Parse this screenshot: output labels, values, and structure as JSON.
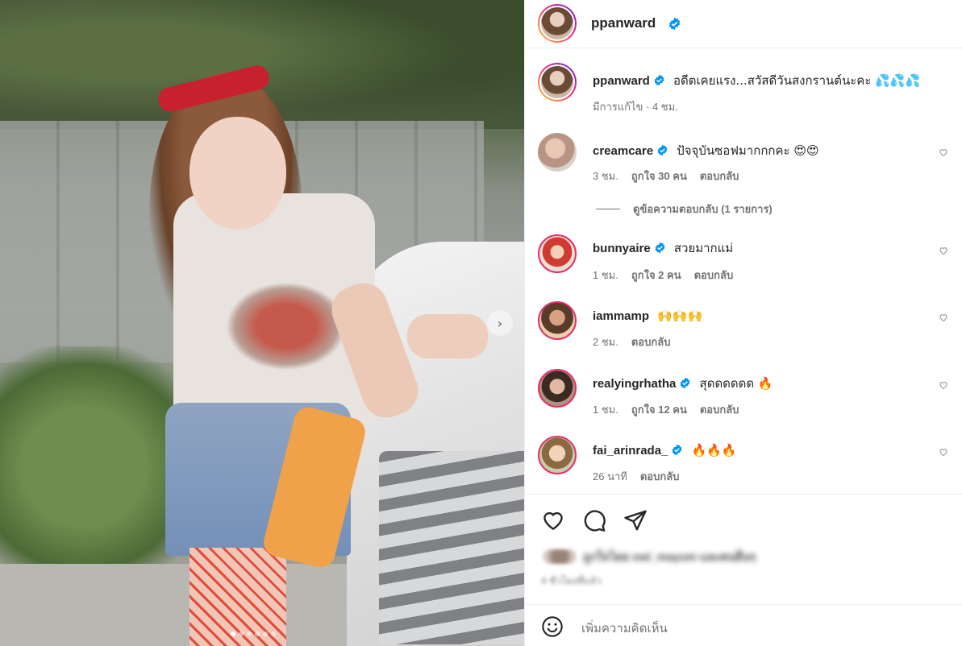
{
  "header": {
    "username": "ppanward"
  },
  "caption": {
    "username": "ppanward",
    "text": "อดีตเคยแรง...สวัสดีวันสงกรานต์นะคะ 💦💦💦",
    "edited": "มีการแก้ไข · 4 ชม."
  },
  "comments": [
    {
      "username": "creamcare",
      "verified": true,
      "text": "ปัจจุบันซอฟมากกกคะ 😍😍",
      "time": "3 ชม.",
      "likes": "ถูกใจ 30 คน",
      "reply": "ตอบกลับ"
    },
    {
      "username": "bunnyaire",
      "verified": true,
      "text": "สวยมากแม่",
      "time": "1 ชม.",
      "likes": "ถูกใจ 2 คน",
      "reply": "ตอบกลับ"
    },
    {
      "username": "iammamp",
      "verified": false,
      "text": "🙌🙌🙌",
      "time": "2 ชม.",
      "reply": "ตอบกลับ"
    },
    {
      "username": "realyingrhatha",
      "verified": true,
      "text": "สุดดดดดด 🔥",
      "time": "1 ชม.",
      "likes": "ถูกใจ 12 คน",
      "reply": "ตอบกลับ"
    },
    {
      "username": "fai_arinrada_",
      "verified": true,
      "text": "🔥🔥🔥",
      "time": "26 นาที",
      "reply": "ตอบกลับ"
    }
  ],
  "view_replies": "ดูข้อความตอบกลับ (1 รายการ)",
  "actions": {
    "likes_text": "ถูกใจโดย owl_mayum และคนอื่นๆ",
    "posted_time": "4 ชั่วโมงที่แล้ว"
  },
  "add_comment": {
    "placeholder": "เพิ่มความคิดเห็น"
  },
  "carousel": {
    "count": 6,
    "current": 1
  },
  "icons": [
    "verified-badge-icon",
    "heart-icon",
    "comment-icon",
    "share-icon",
    "emoji-icon",
    "chevron-right-icon"
  ],
  "colors": {
    "verified": "#0095f6",
    "meta": "#737373",
    "text": "#262626"
  }
}
